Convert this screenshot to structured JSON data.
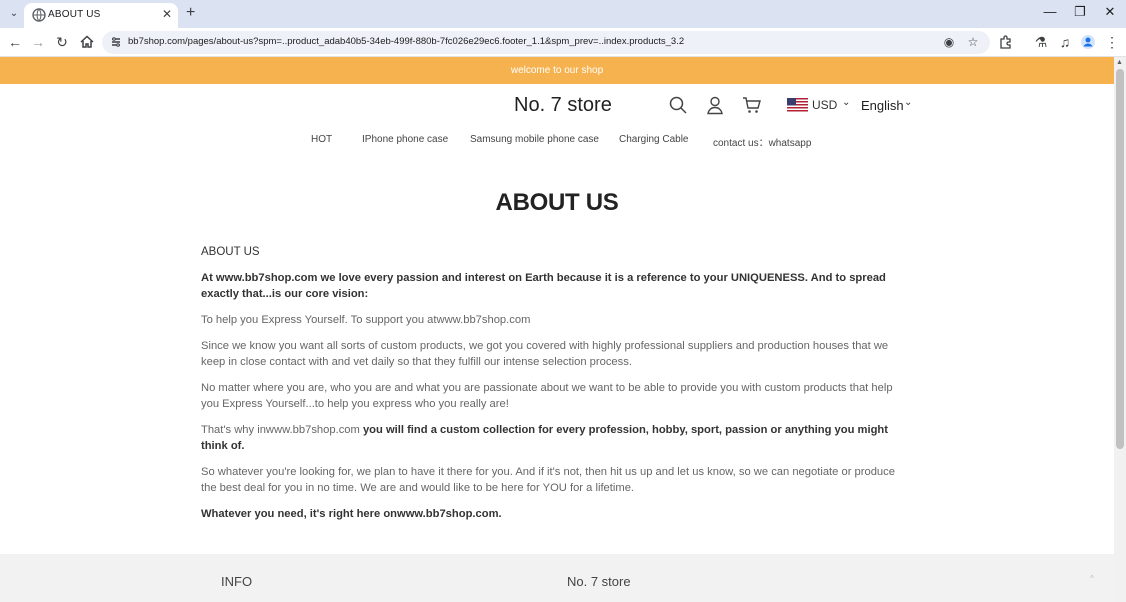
{
  "browser": {
    "tab_title": "ABOUT US",
    "url": "bb7shop.com/pages/about-us?spm=..product_adab40b5-34eb-499f-880b-7fc026e29ec6.footer_1.1&spm_prev=..index.products_3.2",
    "icons": [
      "tab-search-icon",
      "globe-icon",
      "close-icon",
      "plus-icon",
      "minimize-icon",
      "restore-icon",
      "back-icon",
      "forward-icon",
      "reload-icon",
      "home-icon",
      "site-info-icon",
      "eye-off-icon",
      "star-icon",
      "extensions-icon",
      "lab-icon",
      "media-icon",
      "profile-icon",
      "kebab-icon"
    ]
  },
  "banner": {
    "text": "welcome to our shop",
    "color": "#f5b24f"
  },
  "header": {
    "store_name": "No. 7 store",
    "currency": "USD",
    "language": "English"
  },
  "menu": {
    "items": [
      "HOT",
      "IPhone phone case",
      "Samsung mobile phone case",
      "Charging Cable",
      "contact us：whatsapp"
    ]
  },
  "page": {
    "title": "ABOUT US",
    "heading": "ABOUT US",
    "intro": "At www.bb7shop.com we love every passion and interest on Earth because it is a reference to your UNIQUENESS. And to spread exactly that...is our core vision:",
    "p1": "To help you Express Yourself. To support you atwww.bb7shop.com",
    "p2": "Since we know you want all sorts of custom products, we got you covered with highly professional suppliers and production houses that we keep in close contact with and vet daily so that they fulfill our intense selection process.",
    "p3": "No matter where you are, who you are and what you are passionate about we want to be able to provide you with custom products that help you Express Yourself...to help you express who you really are!",
    "p4_pre": "That's why inwww.bb7shop.com",
    "p4_bold": " you will find a custom collection for every profession, hobby, sport, passion or anything you might think of.",
    "p5": "So whatever you're looking for, we plan to have it there for you. And if it's not, then hit us up and let us know, so we can negotiate or produce the best deal for you in no time. We are and would like to be here for YOU for a lifetime.",
    "closing": "Whatever you need, it's right here onwww.bb7shop.com."
  },
  "footer": {
    "col1": "INFO",
    "col2": "No. 7 store"
  }
}
